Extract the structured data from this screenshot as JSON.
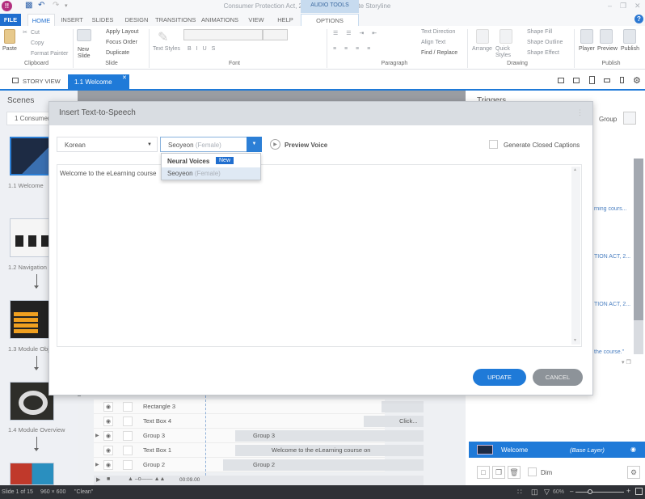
{
  "window": {
    "title": "Consumer Protection Act, 2019.story* - Articulate Storyline",
    "app_logo": "!!",
    "context_group": "AUDIO TOOLS"
  },
  "ribbon_tabs": [
    "FILE",
    "HOME",
    "INSERT",
    "SLIDES",
    "DESIGN",
    "TRANSITIONS",
    "ANIMATIONS",
    "VIEW",
    "HELP",
    "OPTIONS"
  ],
  "ribbon": {
    "clipboard": {
      "paste": "Paste",
      "cut": "Cut",
      "copy": "Copy",
      "format_painter": "Format Painter",
      "label": "Clipboard"
    },
    "slide": {
      "new_slide": "New Slide",
      "apply_layout": "Apply Layout",
      "focus_order": "Focus Order",
      "duplicate": "Duplicate",
      "label": "Slide"
    },
    "font": {
      "text_styles": "Text Styles",
      "label": "Font",
      "font_name": "",
      "font_size": ""
    },
    "paragraph": {
      "text_direction": "Text Direction",
      "align_text": "Align Text",
      "find_replace": "Find / Replace",
      "label": "Paragraph"
    },
    "drawing": {
      "arrange": "Arrange",
      "quick_styles": "Quick Styles",
      "shape_fill": "Shape Fill",
      "shape_outline": "Shape Outline",
      "shape_effect": "Shape Effect",
      "label": "Drawing"
    },
    "publish": {
      "player": "Player",
      "preview": "Preview",
      "publish": "Publish",
      "label": "Publish"
    }
  },
  "view_tabs": {
    "story_view": "STORY VIEW",
    "active_slide": "1.1 Welcome"
  },
  "scenes": {
    "title": "Scenes",
    "selected_scene": "1 Consumer",
    "slides": [
      {
        "label": "1.1 Welcome"
      },
      {
        "label": "1.2 Navigation"
      },
      {
        "label": "1.3 Module Obje"
      },
      {
        "label": "1.4 Module Overview"
      },
      {
        "label": ""
      }
    ]
  },
  "timeline": {
    "rows": [
      {
        "name": "Rectangle 3",
        "expandable": false,
        "bar": ""
      },
      {
        "name": "Text Box 4",
        "expandable": false,
        "bar": "Click..."
      },
      {
        "name": "Group 3",
        "expandable": true,
        "bar": "Group 3"
      },
      {
        "name": "Text Box 1",
        "expandable": false,
        "bar": "Welcome to the eLearning course on"
      },
      {
        "name": "Group 2",
        "expandable": true,
        "bar": "Group 2"
      }
    ],
    "time": "00:09.00"
  },
  "triggers": {
    "title": "Triggers",
    "group_label": "Group",
    "items": [
      "rning cours...",
      "TION ACT, 2...",
      "TION ACT, 2...",
      "the course.\""
    ]
  },
  "layers": {
    "base_name": "Welcome",
    "base_type": "(Base Layer)",
    "dim_label": "Dim"
  },
  "status": {
    "slide_info": "Slide 1 of 15",
    "dimensions": "960 × 600",
    "theme": "\"Clean\"",
    "zoom": "60%"
  },
  "dialog": {
    "title": "Insert Text-to-Speech",
    "language": "Korean",
    "voice_name": "Seoyeon",
    "voice_gender": "(Female)",
    "preview_label": "Preview Voice",
    "closed_captions_label": "Generate Closed Captions",
    "closed_captions_checked": false,
    "dropdown": {
      "header": "Neural Voices",
      "badge": "New",
      "options": [
        {
          "name": "Seoyeon",
          "gender": "(Female)",
          "selected": true
        }
      ]
    },
    "text": "Welcome to the eLearning course",
    "update_label": "UPDATE",
    "cancel_label": "CANCEL"
  },
  "colors": {
    "accent": "#1f7ad8",
    "ribbon_file": "#1f6ecf",
    "cancel": "#8d9399"
  }
}
